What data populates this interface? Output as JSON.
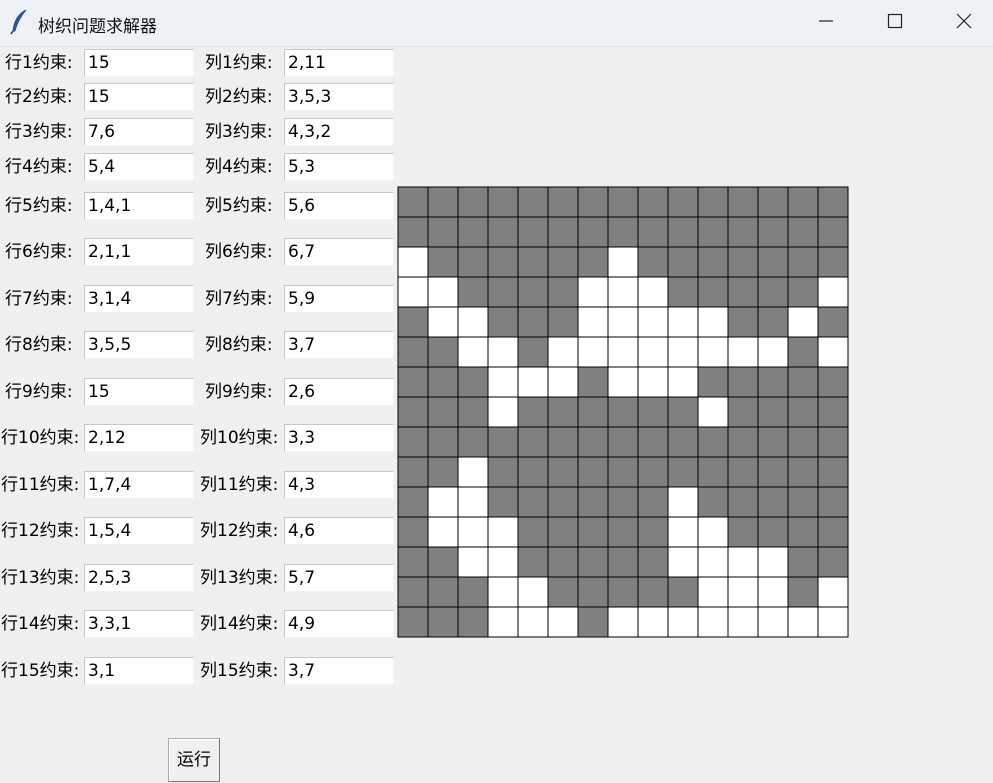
{
  "window": {
    "title": "树织问题求解器",
    "app_icon": "feather-icon",
    "controls": [
      "minimize-icon",
      "maximize-icon",
      "close-icon"
    ]
  },
  "rows": [
    {
      "label": "行1约束:",
      "value": "15"
    },
    {
      "label": "行2约束:",
      "value": "15"
    },
    {
      "label": "行3约束:",
      "value": "7,6"
    },
    {
      "label": "行4约束:",
      "value": "5,4"
    },
    {
      "label": "行5约束:",
      "value": "1,4,1"
    },
    {
      "label": "行6约束:",
      "value": "2,1,1"
    },
    {
      "label": "行7约束:",
      "value": "3,1,4"
    },
    {
      "label": "行8约束:",
      "value": "3,5,5"
    },
    {
      "label": "行9约束:",
      "value": "15"
    },
    {
      "label": "行10约束:",
      "value": "2,12"
    },
    {
      "label": "行11约束:",
      "value": "1,7,4"
    },
    {
      "label": "行12约束:",
      "value": "1,5,4"
    },
    {
      "label": "行13约束:",
      "value": "2,5,3"
    },
    {
      "label": "行14约束:",
      "value": "3,3,1"
    },
    {
      "label": "行15约束:",
      "value": "3,1"
    }
  ],
  "cols": [
    {
      "label": "列1约束:",
      "value": "2,11"
    },
    {
      "label": "列2约束:",
      "value": "3,5,3"
    },
    {
      "label": "列3约束:",
      "value": "4,3,2"
    },
    {
      "label": "列4约束:",
      "value": "5,3"
    },
    {
      "label": "列5约束:",
      "value": "5,6"
    },
    {
      "label": "列6约束:",
      "value": "6,7"
    },
    {
      "label": "列7约束:",
      "value": "5,9"
    },
    {
      "label": "列8约束:",
      "value": "3,7"
    },
    {
      "label": "列9约束:",
      "value": "2,6"
    },
    {
      "label": "列10约束:",
      "value": "3,3"
    },
    {
      "label": "列11约束:",
      "value": "4,3"
    },
    {
      "label": "列12约束:",
      "value": "4,6"
    },
    {
      "label": "列13约束:",
      "value": "5,7"
    },
    {
      "label": "列14约束:",
      "value": "4,9"
    },
    {
      "label": "列15约束:",
      "value": "3,7"
    }
  ],
  "grid": {
    "filled_color": "#808080",
    "empty_color": "#ffffff",
    "cells": [
      "111111111111111",
      "111111111111111",
      "011111101111111",
      "001111000111110",
      "100111000001101",
      "110010000000010",
      "111000100011111",
      "111011111101111",
      "111111111111111",
      "110111111111111",
      "100111111011111",
      "100011111001111",
      "110011111000011",
      "111001111100010",
      "111000100000000"
    ]
  },
  "run_button": {
    "label": "运行"
  }
}
